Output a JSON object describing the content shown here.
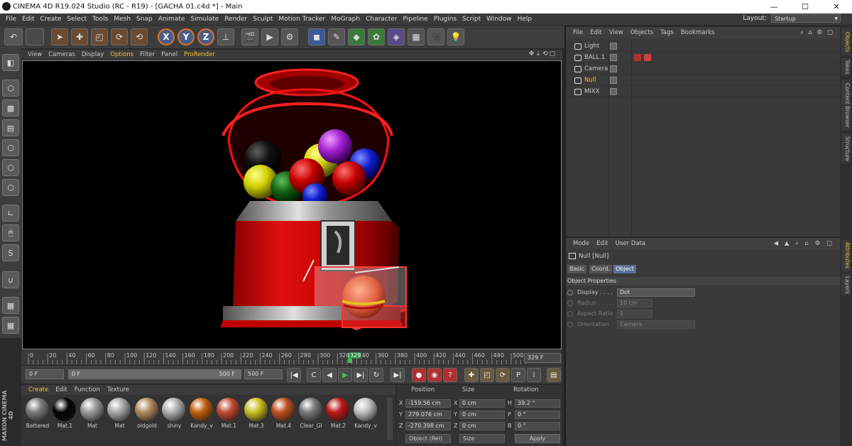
{
  "titlebar": {
    "title": "CINEMA 4D R19.024 Studio (RC - R19) - [GACHA 01.c4d *] - Main",
    "minimize": "—",
    "maximize": "☐",
    "close": "✕"
  },
  "menubar": {
    "items": [
      "File",
      "Edit",
      "Create",
      "Select",
      "Tools",
      "Mesh",
      "Snap",
      "Animate",
      "Simulate",
      "Render",
      "Sculpt",
      "Motion Tracker",
      "MoGraph",
      "Character",
      "Pipeline",
      "Plugins",
      "Script",
      "Window",
      "Help"
    ],
    "layout_label": "Layout:",
    "layout_value": "Startup"
  },
  "toolbar": {
    "axis_x": "X",
    "axis_y": "Y",
    "axis_z": "Z"
  },
  "viewport": {
    "menu": [
      "View",
      "Cameras",
      "Display",
      "Options",
      "Filter",
      "Panel",
      "ProRender"
    ]
  },
  "timeline": {
    "ticks": [
      "0",
      "20",
      "40",
      "60",
      "80",
      "100",
      "120",
      "140",
      "160",
      "180",
      "200",
      "220",
      "240",
      "260",
      "280",
      "300",
      "320",
      "340",
      "360",
      "380",
      "400",
      "420",
      "440",
      "460",
      "480",
      "500"
    ],
    "marker": "329",
    "current_frame": "329 F"
  },
  "transport": {
    "start": "0 F",
    "slider_left": "0 F",
    "slider_right": "500 F",
    "end": "500 F"
  },
  "materials": {
    "menu": [
      "Create",
      "Edit",
      "Function",
      "Texture"
    ],
    "items": [
      {
        "name": "Battered",
        "color": "#7a7a7a"
      },
      {
        "name": "Mat.1",
        "color": "#050505"
      },
      {
        "name": "Mat",
        "color": "#9a9a9a"
      },
      {
        "name": "Mat",
        "color": "#a8a8a8"
      },
      {
        "name": "oldgold",
        "color": "#b08a60"
      },
      {
        "name": "shiny",
        "color": "#b0b0b0"
      },
      {
        "name": "Kandy_v",
        "color": "#c06010"
      },
      {
        "name": "Mat.1",
        "color": "#c04a30"
      },
      {
        "name": "Mat.3",
        "color": "#c8c020"
      },
      {
        "name": "Mat.4",
        "color": "#c05020"
      },
      {
        "name": "Clear_Gl",
        "color": "#7a7a7a"
      },
      {
        "name": "Mat.2",
        "color": "#c01818"
      },
      {
        "name": "Kandy_v",
        "color": "#c0c0c0"
      }
    ]
  },
  "coords": {
    "headers": [
      "Position",
      "Size",
      "Rotation"
    ],
    "rows": [
      {
        "axis": "X",
        "pos": "-159.56 cm",
        "size_axis": "X",
        "size": "0 cm",
        "rot_axis": "H",
        "rot": "39.2 °"
      },
      {
        "axis": "Y",
        "pos": "279.076 cm",
        "size_axis": "Y",
        "size": "0 cm",
        "rot_axis": "P",
        "rot": "0 °"
      },
      {
        "axis": "Z",
        "pos": "-270.398 cm",
        "size_axis": "Z",
        "size": "0 cm",
        "rot_axis": "B",
        "rot": "0 °"
      }
    ],
    "mode": "Object (Rel)",
    "size_mode": "Size",
    "apply": "Apply"
  },
  "objects": {
    "menu": [
      "File",
      "Edit",
      "View",
      "Objects",
      "Tags",
      "Bookmarks"
    ],
    "items": [
      {
        "name": "Light",
        "color": "#dddddd"
      },
      {
        "name": "BALL.1",
        "color": "#dddddd"
      },
      {
        "name": "Camera",
        "color": "#dddddd"
      },
      {
        "name": "Null",
        "color": "#f0c040"
      },
      {
        "name": "MIXX",
        "color": "#dddddd"
      }
    ]
  },
  "attributes": {
    "menu": [
      "Mode",
      "Edit",
      "User Data"
    ],
    "object_title": "Null [Null]",
    "tabs": [
      "Basic",
      "Coord.",
      "Object"
    ],
    "section": "Object Properties",
    "props": [
      {
        "label": "Display . . . .",
        "value": "Dot"
      },
      {
        "label": "Radius . . . . .",
        "value": "10 cm"
      },
      {
        "label": "Aspect Ratio",
        "value": "1"
      },
      {
        "label": "Orientation",
        "value": "Camera"
      }
    ]
  },
  "side_tabs": [
    "Objects",
    "Takes",
    "Content Browser",
    "Structure",
    "Attributes",
    "Layers"
  ],
  "brand": "MAXON CINEMA 4D"
}
